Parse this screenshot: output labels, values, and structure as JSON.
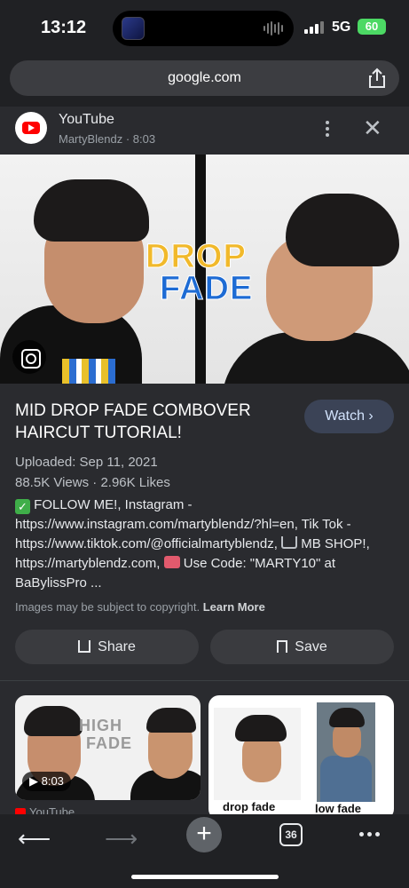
{
  "status": {
    "time": "13:12",
    "network": "5G",
    "battery": "60"
  },
  "browser": {
    "url": "google.com"
  },
  "source": {
    "name": "YouTube",
    "sub": "MartyBlendz · 8:03"
  },
  "hero": {
    "text_top": "DROP",
    "text_bottom": "FADE"
  },
  "details": {
    "title": "MID DROP FADE COMBOVER HAIRCUT TUTORIAL!",
    "watch_label": "Watch",
    "uploaded": "Uploaded: Sep 11, 2021",
    "stats": "88.5K Views · 2.96K Likes",
    "desc_1": "FOLLOW ME!, Instagram - https://www.instagram.com/martyblendz/?hl=en, Tik Tok - https://www.tiktok.com/@officialmartyblendz,",
    "desc_2": "MB SHOP!, https://martyblendz.com,",
    "desc_3": "Use Code: \"MARTY10\" at BaBylissPro ...",
    "copyright": "Images may be subject to copyright.",
    "learn_more": "Learn More",
    "share_label": "Share",
    "save_label": "Save"
  },
  "related": {
    "card1_text_top": "HIGH",
    "card1_text_bottom": "FADE",
    "card1_duration": "8:03",
    "card1_source": "YouTube",
    "card2_label_left": "drop fade",
    "card2_label_right": "low fade"
  },
  "toolbar": {
    "tab_count": "36"
  },
  "colors": {
    "background": "#2a2b2f",
    "accent": "#3b4356",
    "youtube_red": "#ff0000"
  }
}
